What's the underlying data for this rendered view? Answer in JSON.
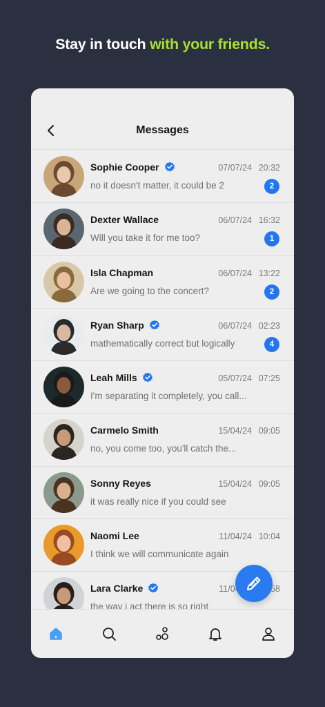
{
  "headline": {
    "part1": "Stay in touch",
    "part2": "with your friends."
  },
  "header": {
    "title": "Messages",
    "back_icon": "chevron-left-icon"
  },
  "messages": [
    {
      "name": "Sophie Cooper",
      "verified": true,
      "date": "07/07/24",
      "time": "20:32",
      "preview": "no it doesn't matter, it could be 2",
      "unread": "2"
    },
    {
      "name": "Dexter Wallace",
      "verified": false,
      "date": "06/07/24",
      "time": "16:32",
      "preview": "Will you take it for me too?",
      "unread": "1"
    },
    {
      "name": "Isla Chapman",
      "verified": false,
      "date": "06/07/24",
      "time": "13:22",
      "preview": "Are we going to the concert?",
      "unread": "2"
    },
    {
      "name": "Ryan Sharp",
      "verified": true,
      "date": "06/07/24",
      "time": "02:23",
      "preview": "mathematically correct but logically",
      "unread": "4"
    },
    {
      "name": "Leah Mills",
      "verified": true,
      "date": "05/07/24",
      "time": "07:25",
      "preview": "I'm separating it completely, you call...",
      "unread": ""
    },
    {
      "name": "Carmelo Smith",
      "verified": false,
      "date": "15/04/24",
      "time": "09:05",
      "preview": "no, you come too, you'll catch the...",
      "unread": ""
    },
    {
      "name": "Sonny Reyes",
      "verified": false,
      "date": "15/04/24",
      "time": "09:05",
      "preview": "it was really nice if you could see",
      "unread": ""
    },
    {
      "name": "Naomi Lee",
      "verified": false,
      "date": "11/04/24",
      "time": "10:04",
      "preview": "I think we will communicate again",
      "unread": ""
    },
    {
      "name": "Lara Clarke",
      "verified": true,
      "date": "11/04/24",
      "time": "10:58",
      "preview": "the way i act there is so right",
      "unread": ""
    }
  ],
  "fab": {
    "icon": "pencil-icon"
  },
  "nav": [
    {
      "icon": "home-icon",
      "active": true
    },
    {
      "icon": "search-icon",
      "active": false
    },
    {
      "icon": "explore-icon",
      "active": false
    },
    {
      "icon": "bell-icon",
      "active": false
    },
    {
      "icon": "profile-icon",
      "active": false
    }
  ],
  "colors": {
    "background": "#2b3041",
    "accent_green": "#a6e22e",
    "primary_blue": "#2277ee",
    "card": "#eeeeee"
  }
}
